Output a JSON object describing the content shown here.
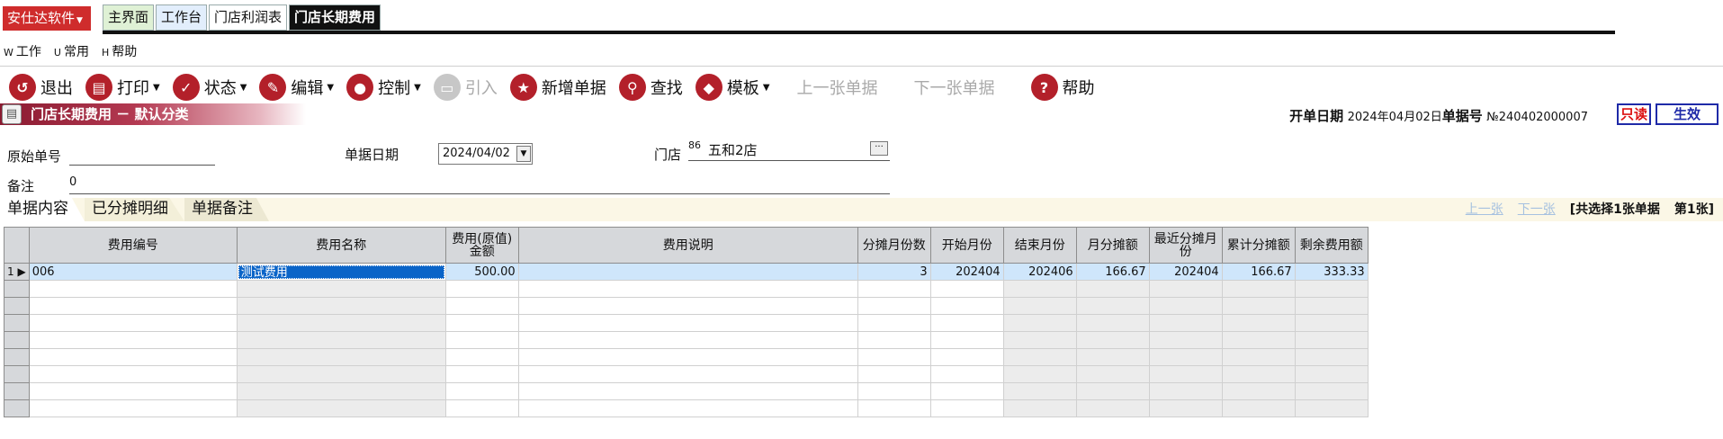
{
  "brand": "安仕达软件",
  "nav_tabs": [
    "主界面",
    "工作台",
    "门店利润表",
    "门店长期费用"
  ],
  "menu": [
    {
      "key": "W",
      "label": "工作"
    },
    {
      "key": "U",
      "label": "常用"
    },
    {
      "key": "H",
      "label": "帮助"
    }
  ],
  "toolbar": {
    "exit": "退出",
    "print": "打印",
    "status": "状态",
    "edit": "编辑",
    "control": "控制",
    "import": "引入",
    "new_doc": "新增单据",
    "find": "查找",
    "template": "模板",
    "prev_doc": "上一张单据",
    "next_doc": "下一张单据",
    "help": "帮助"
  },
  "page_title": "门店长期费用 － 默认分类",
  "header": {
    "open_date_label": "开单日期",
    "open_date": "2024年04月02日",
    "doc_no_label": "单据号",
    "doc_no": "№240402000007",
    "readonly_badge": "只读",
    "effective_badge": "生效"
  },
  "form": {
    "orig_no_label": "原始单号",
    "orig_no": "",
    "doc_date_label": "单据日期",
    "doc_date": "2024/04/02",
    "store_label": "门店",
    "store_code": "86",
    "store_name": "五和2店",
    "remark_label": "备注",
    "remark": "0"
  },
  "content_tabs": [
    "单据内容",
    "已分摊明细",
    "单据备注"
  ],
  "pager": {
    "prev": "上一张",
    "next": "下一张",
    "summary": "[共选择1张单据",
    "current": "第1张]"
  },
  "grid": {
    "columns": [
      "费用编号",
      "费用名称",
      "费用(原值)金额",
      "费用说明",
      "分摊月份数",
      "开始月份",
      "结束月份",
      "月分摊额",
      "最近分摊月份",
      "累计分摊额",
      "剩余费用额"
    ],
    "rows": [
      {
        "index": "1",
        "code": "006",
        "name": "测试费用",
        "amount": "500.00",
        "desc": "",
        "months": "3",
        "start": "202404",
        "end": "202406",
        "monthly": "166.67",
        "last_month": "202404",
        "accumulated": "166.67",
        "remaining": "333.33"
      }
    ]
  }
}
